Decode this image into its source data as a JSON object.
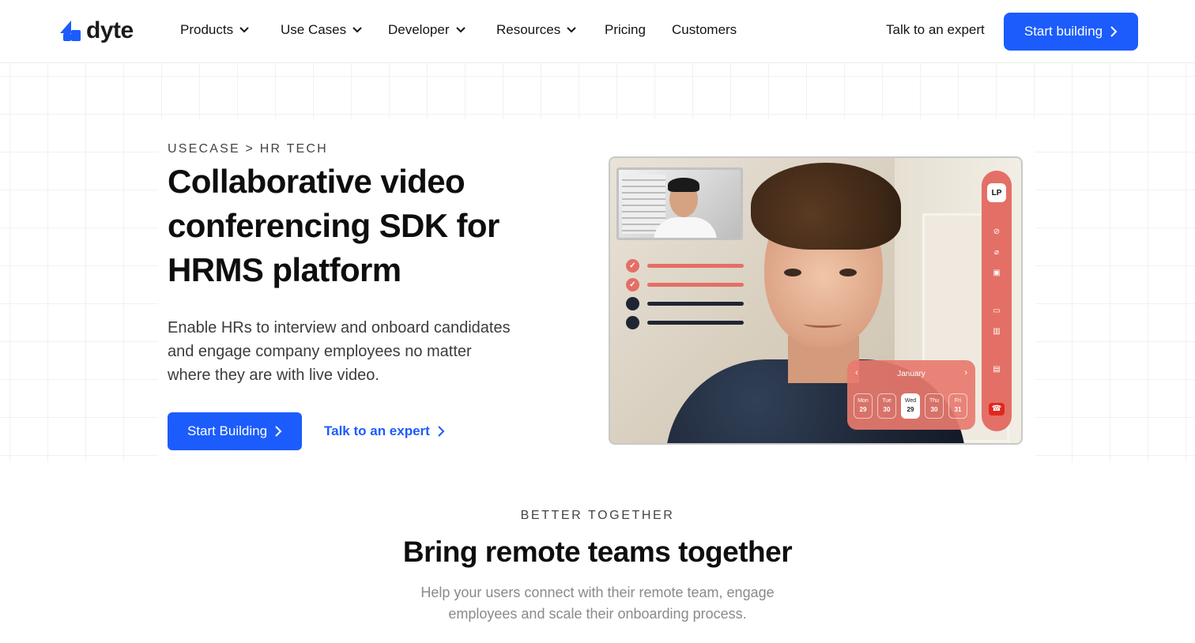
{
  "nav": {
    "logo_text": "dyte",
    "items": [
      {
        "label": "Products",
        "has_dropdown": true
      },
      {
        "label": "Use Cases",
        "has_dropdown": true
      },
      {
        "label": "Developer",
        "has_dropdown": true
      },
      {
        "label": "Resources",
        "has_dropdown": true
      },
      {
        "label": "Pricing",
        "has_dropdown": false
      },
      {
        "label": "Customers",
        "has_dropdown": false
      }
    ],
    "expert_label": "Talk to an expert",
    "cta_label": "Start building"
  },
  "hero": {
    "eyebrow": "USECASE > HR TECH",
    "title": "Collaborative video conferencing SDK for HRMS platform",
    "lead": "Enable HRs to interview and onboard candidates and engage company employees no matter where they are with live video.",
    "primary_label": "Start Building",
    "link_label": "Talk to an expert"
  },
  "video_mock": {
    "participant_initials": "LP",
    "calendar": {
      "month": "January",
      "days": [
        {
          "weekday": "Mon",
          "date": "29"
        },
        {
          "weekday": "Tue",
          "date": "30"
        },
        {
          "weekday": "Wed",
          "date": "29",
          "selected": true
        },
        {
          "weekday": "Thu",
          "date": "30"
        },
        {
          "weekday": "Fri",
          "date": "31"
        }
      ]
    },
    "checklist": [
      {
        "done": true
      },
      {
        "done": true
      },
      {
        "done": false
      },
      {
        "done": false
      }
    ]
  },
  "section2": {
    "eyebrow": "BETTER TOGETHER",
    "title": "Bring remote teams together",
    "subtitle": "Help your users connect with their remote team, engage employees and scale their onboarding process."
  },
  "colors": {
    "brand_blue": "#1c5cfc",
    "accent_coral": "#e46f66",
    "text_dark": "#0e0e0e"
  },
  "icons": [
    "dyte-logo-icon",
    "chevron-down-icon",
    "chevron-right-icon",
    "check-icon",
    "mic-off-icon",
    "video-off-icon",
    "screen-share-icon",
    "chat-icon",
    "hang-up-icon"
  ]
}
